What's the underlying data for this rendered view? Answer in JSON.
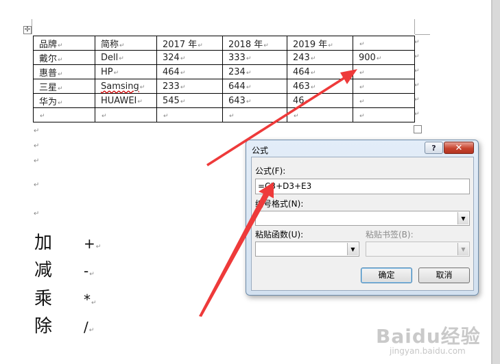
{
  "table": {
    "rows": [
      [
        "品牌",
        "简称",
        "2017 年",
        "2018 年",
        "2019 年",
        ""
      ],
      [
        "戴尔",
        "Dell",
        "324",
        "333",
        "243",
        "900"
      ],
      [
        "惠普",
        "HP",
        "464",
        "234",
        "464",
        ""
      ],
      [
        "三星",
        "Samsing",
        "233",
        "644",
        "463",
        ""
      ],
      [
        "华为",
        "HUAWEI",
        "545",
        "643",
        "46",
        ""
      ],
      [
        "",
        "",
        "",
        "",
        "",
        ""
      ]
    ]
  },
  "operators": [
    {
      "name": "加",
      "symbol": "+"
    },
    {
      "name": "减",
      "symbol": "-"
    },
    {
      "name": "乘",
      "symbol": "*"
    },
    {
      "name": "除",
      "symbol": "/"
    }
  ],
  "dialog": {
    "title": "公式",
    "help": "?",
    "close": "✕",
    "formula_label": "公式(F):",
    "formula_value": "=C3+D3+E3",
    "number_format_label": "编号格式(N):",
    "paste_function_label": "粘贴函数(U):",
    "paste_bookmark_label": "粘贴书签(B):",
    "ok": "确定",
    "cancel": "取消"
  },
  "watermark": {
    "brand": "Baidu经验",
    "url": "jingyan.baidu.com"
  },
  "colors": {
    "arrow": "#ee3a3a",
    "close_button": "#c7442f"
  }
}
